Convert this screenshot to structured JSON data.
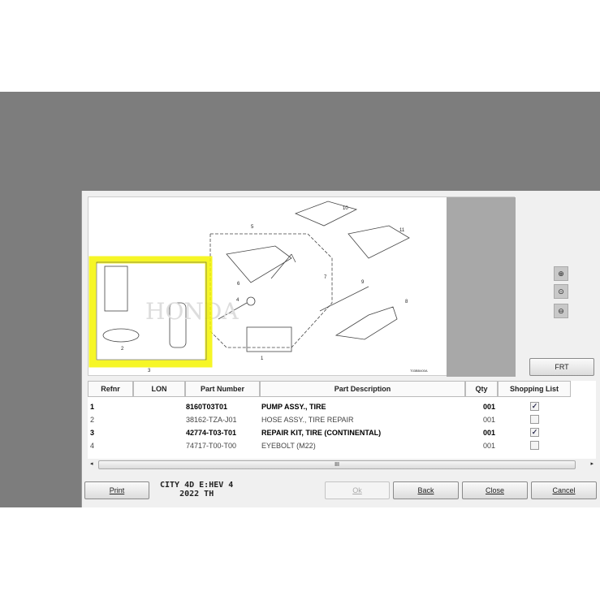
{
  "diagram": {
    "callouts": [
      "1",
      "2",
      "3",
      "4",
      "5",
      "6",
      "7",
      "8",
      "9",
      "10",
      "11"
    ],
    "code": "T03BB400A",
    "watermark": "HONDA",
    "highlight_color": "#f5f500"
  },
  "zoom": {
    "in": "zoom-in",
    "fit": "zoom-fit",
    "out": "zoom-out"
  },
  "frt_label": "FRT",
  "table": {
    "headers": [
      "Refnr",
      "LON",
      "Part Number",
      "Part Description",
      "Qty",
      "Shopping List"
    ],
    "rows": [
      {
        "refnr": "1",
        "lon": "",
        "part_number": "8160T03T01",
        "description": "PUMP ASSY., TIRE",
        "qty": "001",
        "checked": true,
        "bold": true
      },
      {
        "refnr": "2",
        "lon": "",
        "part_number": "38162-TZA-J01",
        "description": "HOSE ASSY., TIRE REPAIR",
        "qty": "001",
        "checked": false,
        "bold": false
      },
      {
        "refnr": "3",
        "lon": "",
        "part_number": "42774-T03-T01",
        "description": "REPAIR KIT, TIRE (CONTINENTAL)",
        "qty": "001",
        "checked": true,
        "bold": true
      },
      {
        "refnr": "4",
        "lon": "",
        "part_number": "74717-T00-T00",
        "description": "EYEBOLT (M22)",
        "qty": "001",
        "checked": false,
        "bold": false
      }
    ]
  },
  "scrollbar": {
    "grip": "III"
  },
  "model": {
    "line1": "CITY 4D E:HEV  4",
    "line2": "2022  TH"
  },
  "buttons": {
    "print": "Print",
    "ok": "Ok",
    "back": "Back",
    "close": "Close",
    "cancel": "Cancel"
  }
}
